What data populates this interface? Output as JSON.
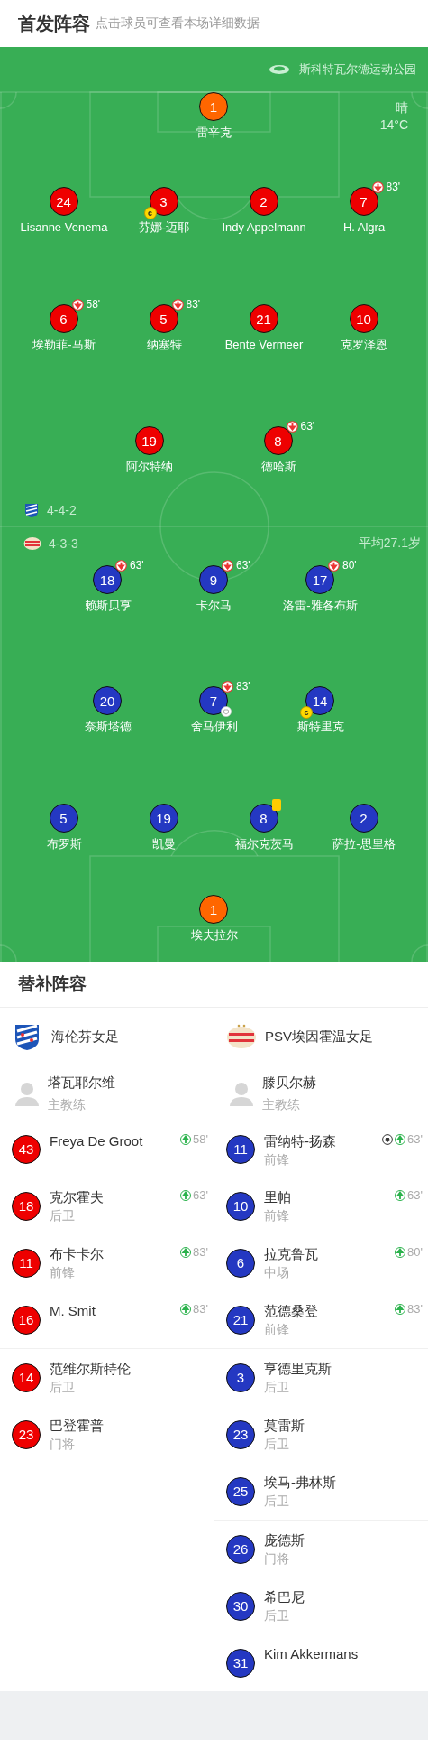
{
  "header": {
    "title": "首发阵容",
    "hint": "点击球员可查看本场详细数据"
  },
  "pitch": {
    "stadium": "斯科特瓦尔德运动公园",
    "weather": "晴",
    "temperature": "14°C",
    "home": {
      "formation": "4-4-2",
      "lines": [
        [
          {
            "number": "1",
            "name": "雷辛克",
            "color": "#ff6600"
          }
        ],
        [
          {
            "number": "24",
            "name": "Lisanne Venema",
            "color": "#ee0000"
          },
          {
            "number": "3",
            "name": "芬娜-迈耶",
            "color": "#ee0000",
            "events": [
              {
                "kind": "captain",
                "label": "c"
              }
            ]
          },
          {
            "number": "2",
            "name": "Indy Appelmann",
            "color": "#ee0000"
          },
          {
            "number": "7",
            "name": "H. Algra",
            "color": "#ee0000",
            "events": [
              {
                "kind": "sub_off",
                "minute": "83'"
              }
            ]
          }
        ],
        [
          {
            "number": "6",
            "name": "埃勒菲-马斯",
            "color": "#ee0000",
            "events": [
              {
                "kind": "sub_off",
                "minute": "58'"
              }
            ]
          },
          {
            "number": "5",
            "name": "纳塞特",
            "color": "#ee0000",
            "events": [
              {
                "kind": "sub_off",
                "minute": "83'"
              }
            ]
          },
          {
            "number": "21",
            "name": "Bente Vermeer",
            "color": "#ee0000"
          },
          {
            "number": "10",
            "name": "克罗泽恩",
            "color": "#ee0000"
          }
        ],
        [
          {
            "number": "19",
            "name": "阿尔特纳",
            "color": "#ee0000"
          },
          {
            "number": "8",
            "name": "德哈斯",
            "color": "#ee0000",
            "events": [
              {
                "kind": "sub_off",
                "minute": "63'"
              }
            ]
          }
        ]
      ]
    },
    "away": {
      "formation": "4-3-3",
      "average_age": "平均27.1岁",
      "lines": [
        [
          {
            "number": "18",
            "name": "赖斯贝亨",
            "color": "#2438c2",
            "events": [
              {
                "kind": "sub_off",
                "minute": "63'"
              }
            ]
          },
          {
            "number": "9",
            "name": "卡尔马",
            "color": "#2438c2",
            "events": [
              {
                "kind": "sub_off",
                "minute": "63'"
              }
            ]
          },
          {
            "number": "17",
            "name": "洛雷-雅各布斯",
            "color": "#2438c2",
            "events": [
              {
                "kind": "sub_off",
                "minute": "80'"
              }
            ]
          }
        ],
        [
          {
            "number": "20",
            "name": "奈斯塔德",
            "color": "#2438c2"
          },
          {
            "number": "7",
            "name": "舍马伊利",
            "color": "#2438c2",
            "events": [
              {
                "kind": "sub_off",
                "minute": "83'"
              },
              {
                "kind": "goal"
              }
            ]
          },
          {
            "number": "14",
            "name": "斯特里克",
            "color": "#2438c2",
            "events": [
              {
                "kind": "captain",
                "label": "c"
              }
            ]
          }
        ],
        [
          {
            "number": "5",
            "name": "布罗斯",
            "color": "#2438c2"
          },
          {
            "number": "19",
            "name": "凯曼",
            "color": "#2438c2"
          },
          {
            "number": "8",
            "name": "福尔克茨马",
            "color": "#2438c2",
            "events": [
              {
                "kind": "yellow_card"
              }
            ]
          },
          {
            "number": "2",
            "name": "萨拉-思里格",
            "color": "#2438c2"
          }
        ],
        [
          {
            "number": "1",
            "name": "埃夫拉尔",
            "color": "#ff6600"
          }
        ]
      ]
    }
  },
  "substitutes": {
    "title": "替补阵容",
    "teams": [
      {
        "name": "海伦芬女足",
        "coach": {
          "name": "塔瓦耶尔维",
          "role": "主教练"
        },
        "groups": [
          [
            {
              "number": "43",
              "name": "Freya De Groot",
              "color": "#ee0000",
              "events": [
                {
                  "kind": "sub_on",
                  "minute": "58'"
                }
              ]
            }
          ],
          [
            {
              "number": "18",
              "name": "克尔霍夫",
              "position": "后卫",
              "color": "#ee0000",
              "events": [
                {
                  "kind": "sub_on",
                  "minute": "63'"
                }
              ]
            },
            {
              "number": "11",
              "name": "布卡卡尔",
              "position": "前锋",
              "color": "#ee0000",
              "events": [
                {
                  "kind": "sub_on",
                  "minute": "83'"
                }
              ]
            },
            {
              "number": "16",
              "name": "M. Smit",
              "color": "#ee0000",
              "events": [
                {
                  "kind": "sub_on",
                  "minute": "83'"
                }
              ]
            }
          ],
          [
            {
              "number": "14",
              "name": "范维尔斯特伦",
              "position": "后卫",
              "color": "#ee0000"
            },
            {
              "number": "23",
              "name": "巴登霍普",
              "position": "门将",
              "color": "#ee0000"
            }
          ]
        ]
      },
      {
        "name": "PSV埃因霍温女足",
        "coach": {
          "name": "滕贝尔赫",
          "role": "主教练"
        },
        "groups": [
          [
            {
              "number": "11",
              "name": "雷纳特-扬森",
              "position": "前锋",
              "color": "#2438c2",
              "events": [
                {
                  "kind": "goal"
                },
                {
                  "kind": "sub_on",
                  "minute": "63'"
                }
              ]
            }
          ],
          [
            {
              "number": "10",
              "name": "里帕",
              "position": "前锋",
              "color": "#2438c2",
              "events": [
                {
                  "kind": "sub_on",
                  "minute": "63'"
                }
              ]
            },
            {
              "number": "6",
              "name": "拉克鲁瓦",
              "position": "中场",
              "color": "#2438c2",
              "events": [
                {
                  "kind": "sub_on",
                  "minute": "80'"
                }
              ]
            },
            {
              "number": "21",
              "name": "范德桑登",
              "position": "前锋",
              "color": "#2438c2",
              "events": [
                {
                  "kind": "sub_on",
                  "minute": "83'"
                }
              ]
            }
          ],
          [
            {
              "number": "3",
              "name": "亨德里克斯",
              "position": "后卫",
              "color": "#2438c2"
            },
            {
              "number": "23",
              "name": "莫雷斯",
              "position": "后卫",
              "color": "#2438c2"
            },
            {
              "number": "25",
              "name": "埃马-弗林斯",
              "position": "后卫",
              "color": "#2438c2"
            }
          ],
          [
            {
              "number": "26",
              "name": "庞德斯",
              "position": "门将",
              "color": "#2438c2"
            },
            {
              "number": "30",
              "name": "希巴尼",
              "position": "后卫",
              "color": "#2438c2"
            },
            {
              "number": "31",
              "name": "Kim Akkermans",
              "color": "#2438c2"
            }
          ]
        ]
      }
    ]
  }
}
